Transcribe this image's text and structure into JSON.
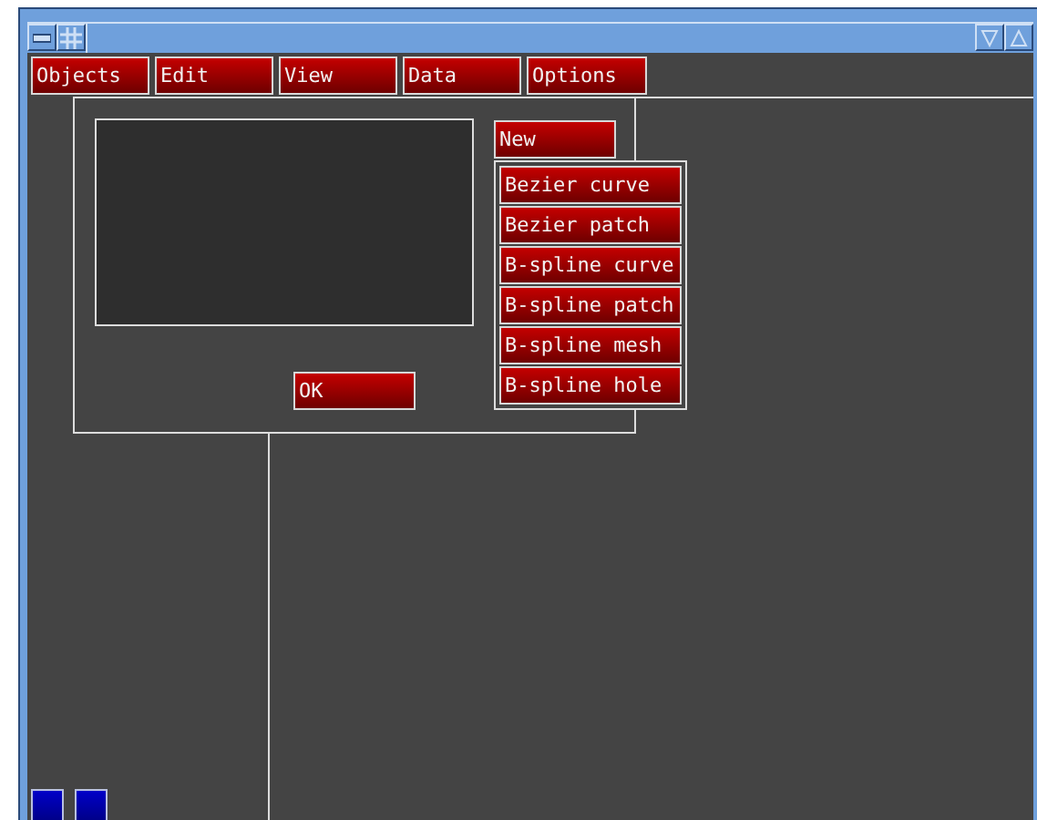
{
  "menu_bar": [
    {
      "label": "Objects"
    },
    {
      "label": "Edit"
    },
    {
      "label": "View"
    },
    {
      "label": "Data"
    },
    {
      "label": "Options"
    }
  ],
  "dialog": {
    "new_button": "New",
    "ok_button": "OK"
  },
  "new_menu": {
    "items": [
      "Bezier curve",
      "Bezier patch",
      "B-spline curve",
      "B-spline patch",
      "B-spline mesh",
      "B-spline hole"
    ]
  }
}
